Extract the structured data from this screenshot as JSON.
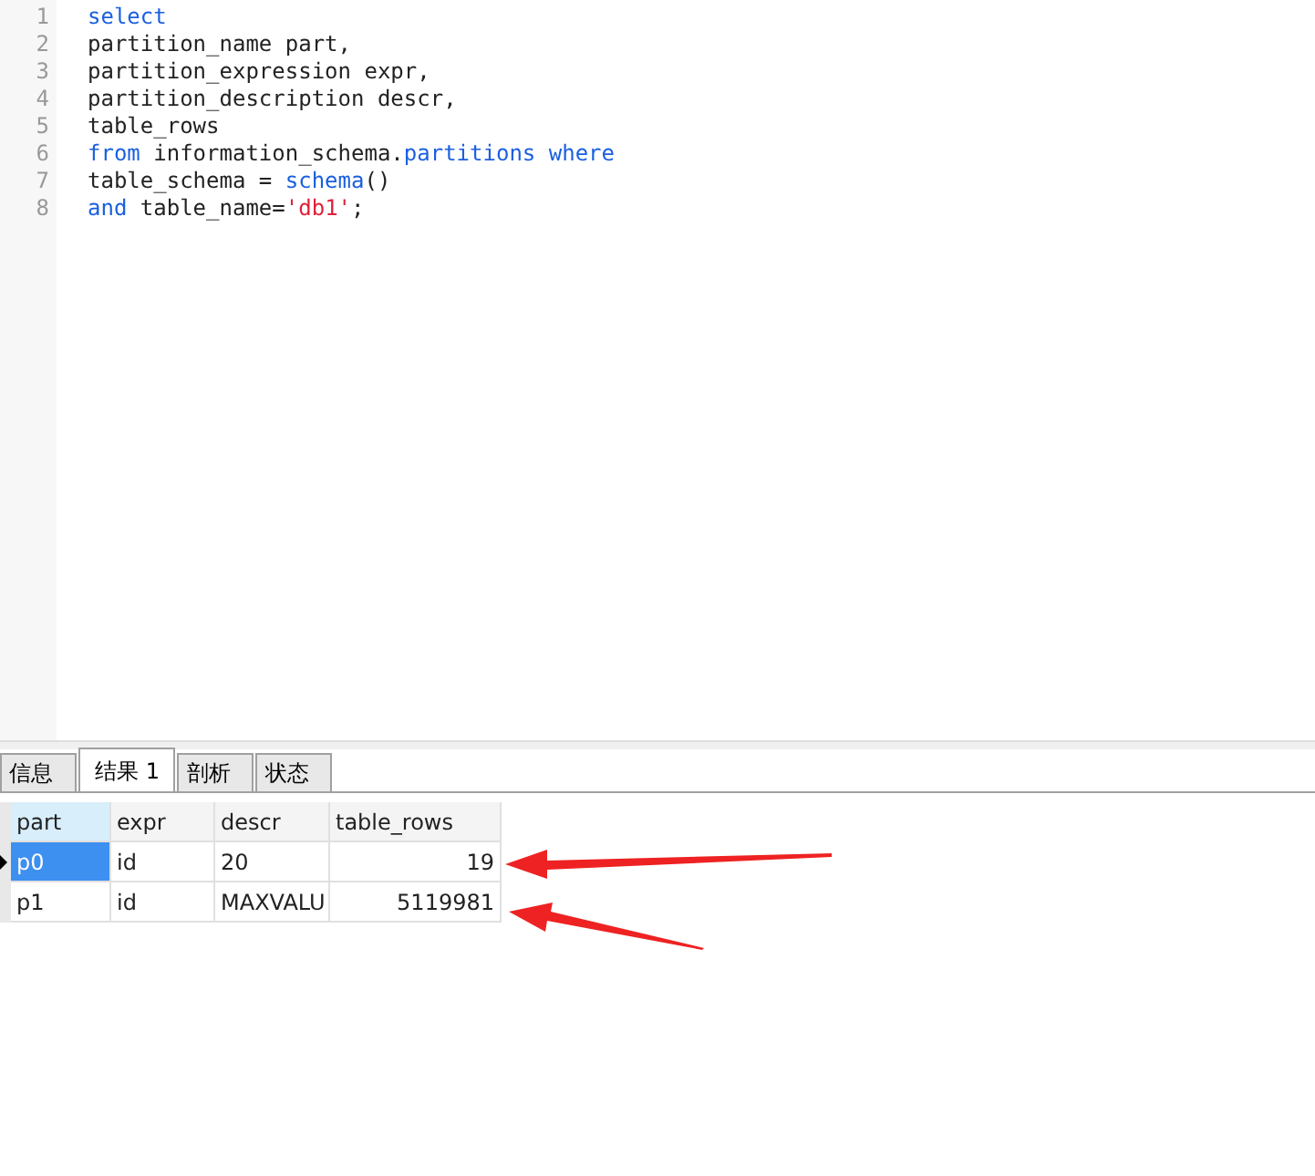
{
  "editor": {
    "lines": [
      {
        "number": "1",
        "tokens": [
          {
            "kind": "keyword",
            "text": "select"
          }
        ]
      },
      {
        "number": "2",
        "tokens": [
          {
            "kind": "plain",
            "text": "partition_name part,"
          }
        ]
      },
      {
        "number": "3",
        "tokens": [
          {
            "kind": "plain",
            "text": "partition_expression expr,"
          }
        ]
      },
      {
        "number": "4",
        "tokens": [
          {
            "kind": "plain",
            "text": "partition_description descr,"
          }
        ]
      },
      {
        "number": "5",
        "tokens": [
          {
            "kind": "plain",
            "text": "table_rows"
          }
        ]
      },
      {
        "number": "6",
        "tokens": [
          {
            "kind": "keyword",
            "text": "from"
          },
          {
            "kind": "plain",
            "text": " information_schema."
          },
          {
            "kind": "keyword",
            "text": "partitions where"
          }
        ]
      },
      {
        "number": "7",
        "tokens": [
          {
            "kind": "plain",
            "text": "table_schema = "
          },
          {
            "kind": "keyword",
            "text": "schema"
          },
          {
            "kind": "plain",
            "text": "()"
          }
        ]
      },
      {
        "number": "8",
        "tokens": [
          {
            "kind": "keyword",
            "text": "and"
          },
          {
            "kind": "plain",
            "text": " table_name="
          },
          {
            "kind": "string",
            "text": "'db1'"
          },
          {
            "kind": "plain",
            "text": ";"
          }
        ]
      }
    ]
  },
  "tabs": [
    {
      "label": "信息",
      "selected": false
    },
    {
      "label": "结果 1",
      "selected": true
    },
    {
      "label": "剖析",
      "selected": false
    },
    {
      "label": "状态",
      "selected": false
    }
  ],
  "table": {
    "columns": [
      "part",
      "expr",
      "descr",
      "table_rows"
    ],
    "rows": [
      {
        "selected": true,
        "cells": [
          "p0",
          "id",
          "20",
          "19"
        ]
      },
      {
        "selected": false,
        "cells": [
          "p1",
          "id",
          "MAXVALU",
          "5119981"
        ]
      }
    ]
  }
}
